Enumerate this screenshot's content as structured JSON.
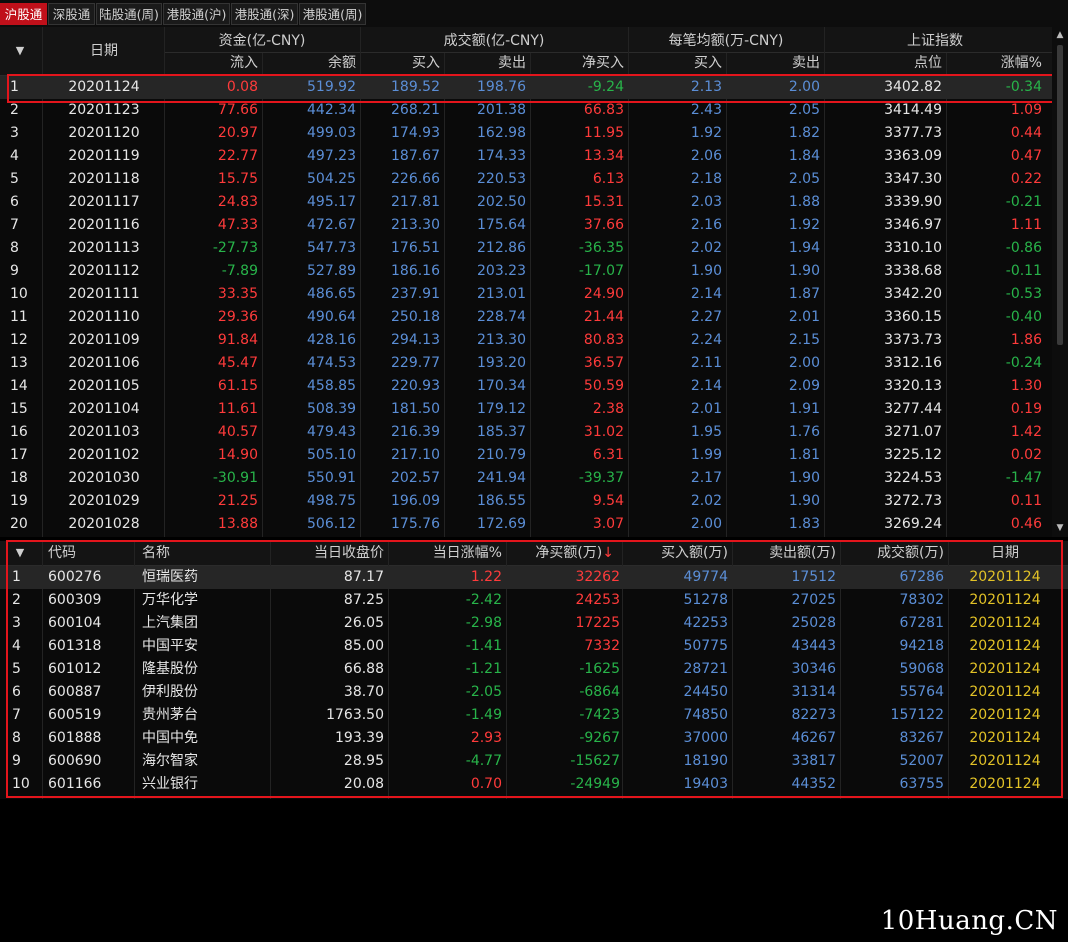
{
  "tabs": [
    "沪股通",
    "深股通",
    "陆股通(周)",
    "港股通(沪)",
    "港股通(深)",
    "港股通(周)"
  ],
  "top_header": {
    "sort_arrow": "▼",
    "date": "日期",
    "groups": [
      "资金(亿-CNY)",
      "成交额(亿-CNY)",
      "每笔均额(万-CNY)",
      "上证指数"
    ],
    "subs": [
      "流入",
      "余额",
      "买入",
      "卖出",
      "净买入",
      "买入",
      "卖出",
      "点位",
      "涨幅%"
    ]
  },
  "top_rows": [
    {
      "idx": "1",
      "date": "20201124",
      "inflow": "0.08",
      "balance": "519.92",
      "buy": "189.52",
      "sell": "198.76",
      "net": "-9.24",
      "avg_buy": "2.13",
      "avg_sell": "2.00",
      "index": "3402.82",
      "chg": "-0.34"
    },
    {
      "idx": "2",
      "date": "20201123",
      "inflow": "77.66",
      "balance": "442.34",
      "buy": "268.21",
      "sell": "201.38",
      "net": "66.83",
      "avg_buy": "2.43",
      "avg_sell": "2.05",
      "index": "3414.49",
      "chg": "1.09"
    },
    {
      "idx": "3",
      "date": "20201120",
      "inflow": "20.97",
      "balance": "499.03",
      "buy": "174.93",
      "sell": "162.98",
      "net": "11.95",
      "avg_buy": "1.92",
      "avg_sell": "1.82",
      "index": "3377.73",
      "chg": "0.44"
    },
    {
      "idx": "4",
      "date": "20201119",
      "inflow": "22.77",
      "balance": "497.23",
      "buy": "187.67",
      "sell": "174.33",
      "net": "13.34",
      "avg_buy": "2.06",
      "avg_sell": "1.84",
      "index": "3363.09",
      "chg": "0.47"
    },
    {
      "idx": "5",
      "date": "20201118",
      "inflow": "15.75",
      "balance": "504.25",
      "buy": "226.66",
      "sell": "220.53",
      "net": "6.13",
      "avg_buy": "2.18",
      "avg_sell": "2.05",
      "index": "3347.30",
      "chg": "0.22"
    },
    {
      "idx": "6",
      "date": "20201117",
      "inflow": "24.83",
      "balance": "495.17",
      "buy": "217.81",
      "sell": "202.50",
      "net": "15.31",
      "avg_buy": "2.03",
      "avg_sell": "1.88",
      "index": "3339.90",
      "chg": "-0.21"
    },
    {
      "idx": "7",
      "date": "20201116",
      "inflow": "47.33",
      "balance": "472.67",
      "buy": "213.30",
      "sell": "175.64",
      "net": "37.66",
      "avg_buy": "2.16",
      "avg_sell": "1.92",
      "index": "3346.97",
      "chg": "1.11"
    },
    {
      "idx": "8",
      "date": "20201113",
      "inflow": "-27.73",
      "balance": "547.73",
      "buy": "176.51",
      "sell": "212.86",
      "net": "-36.35",
      "avg_buy": "2.02",
      "avg_sell": "1.94",
      "index": "3310.10",
      "chg": "-0.86"
    },
    {
      "idx": "9",
      "date": "20201112",
      "inflow": "-7.89",
      "balance": "527.89",
      "buy": "186.16",
      "sell": "203.23",
      "net": "-17.07",
      "avg_buy": "1.90",
      "avg_sell": "1.90",
      "index": "3338.68",
      "chg": "-0.11"
    },
    {
      "idx": "10",
      "date": "20201111",
      "inflow": "33.35",
      "balance": "486.65",
      "buy": "237.91",
      "sell": "213.01",
      "net": "24.90",
      "avg_buy": "2.14",
      "avg_sell": "1.87",
      "index": "3342.20",
      "chg": "-0.53"
    },
    {
      "idx": "11",
      "date": "20201110",
      "inflow": "29.36",
      "balance": "490.64",
      "buy": "250.18",
      "sell": "228.74",
      "net": "21.44",
      "avg_buy": "2.27",
      "avg_sell": "2.01",
      "index": "3360.15",
      "chg": "-0.40"
    },
    {
      "idx": "12",
      "date": "20201109",
      "inflow": "91.84",
      "balance": "428.16",
      "buy": "294.13",
      "sell": "213.30",
      "net": "80.83",
      "avg_buy": "2.24",
      "avg_sell": "2.15",
      "index": "3373.73",
      "chg": "1.86"
    },
    {
      "idx": "13",
      "date": "20201106",
      "inflow": "45.47",
      "balance": "474.53",
      "buy": "229.77",
      "sell": "193.20",
      "net": "36.57",
      "avg_buy": "2.11",
      "avg_sell": "2.00",
      "index": "3312.16",
      "chg": "-0.24"
    },
    {
      "idx": "14",
      "date": "20201105",
      "inflow": "61.15",
      "balance": "458.85",
      "buy": "220.93",
      "sell": "170.34",
      "net": "50.59",
      "avg_buy": "2.14",
      "avg_sell": "2.09",
      "index": "3320.13",
      "chg": "1.30"
    },
    {
      "idx": "15",
      "date": "20201104",
      "inflow": "11.61",
      "balance": "508.39",
      "buy": "181.50",
      "sell": "179.12",
      "net": "2.38",
      "avg_buy": "2.01",
      "avg_sell": "1.91",
      "index": "3277.44",
      "chg": "0.19"
    },
    {
      "idx": "16",
      "date": "20201103",
      "inflow": "40.57",
      "balance": "479.43",
      "buy": "216.39",
      "sell": "185.37",
      "net": "31.02",
      "avg_buy": "1.95",
      "avg_sell": "1.76",
      "index": "3271.07",
      "chg": "1.42"
    },
    {
      "idx": "17",
      "date": "20201102",
      "inflow": "14.90",
      "balance": "505.10",
      "buy": "217.10",
      "sell": "210.79",
      "net": "6.31",
      "avg_buy": "1.99",
      "avg_sell": "1.81",
      "index": "3225.12",
      "chg": "0.02"
    },
    {
      "idx": "18",
      "date": "20201030",
      "inflow": "-30.91",
      "balance": "550.91",
      "buy": "202.57",
      "sell": "241.94",
      "net": "-39.37",
      "avg_buy": "2.17",
      "avg_sell": "1.90",
      "index": "3224.53",
      "chg": "-1.47"
    },
    {
      "idx": "19",
      "date": "20201029",
      "inflow": "21.25",
      "balance": "498.75",
      "buy": "196.09",
      "sell": "186.55",
      "net": "9.54",
      "avg_buy": "2.02",
      "avg_sell": "1.90",
      "index": "3272.73",
      "chg": "0.11"
    },
    {
      "idx": "20",
      "date": "20201028",
      "inflow": "13.88",
      "balance": "506.12",
      "buy": "175.76",
      "sell": "172.69",
      "net": "3.07",
      "avg_buy": "2.00",
      "avg_sell": "1.83",
      "index": "3269.24",
      "chg": "0.46"
    }
  ],
  "bottom_header": {
    "sort_arrow": "▼",
    "cols": [
      "代码",
      "名称",
      "当日收盘价",
      "当日涨幅%",
      "净买额(万)",
      "买入额(万)",
      "卖出额(万)",
      "成交额(万)",
      "日期"
    ],
    "sort_indicator": "↓"
  },
  "bottom_rows": [
    {
      "idx": "1",
      "code": "600276",
      "name": "恒瑞医药",
      "close": "87.17",
      "chg": "1.22",
      "net": "32262",
      "buy": "49774",
      "sell": "17512",
      "amount": "67286",
      "date": "20201124"
    },
    {
      "idx": "2",
      "code": "600309",
      "name": "万华化学",
      "close": "87.25",
      "chg": "-2.42",
      "net": "24253",
      "buy": "51278",
      "sell": "27025",
      "amount": "78302",
      "date": "20201124"
    },
    {
      "idx": "3",
      "code": "600104",
      "name": "上汽集团",
      "close": "26.05",
      "chg": "-2.98",
      "net": "17225",
      "buy": "42253",
      "sell": "25028",
      "amount": "67281",
      "date": "20201124"
    },
    {
      "idx": "4",
      "code": "601318",
      "name": "中国平安",
      "close": "85.00",
      "chg": "-1.41",
      "net": "7332",
      "buy": "50775",
      "sell": "43443",
      "amount": "94218",
      "date": "20201124"
    },
    {
      "idx": "5",
      "code": "601012",
      "name": "隆基股份",
      "close": "66.88",
      "chg": "-1.21",
      "net": "-1625",
      "buy": "28721",
      "sell": "30346",
      "amount": "59068",
      "date": "20201124"
    },
    {
      "idx": "6",
      "code": "600887",
      "name": "伊利股份",
      "close": "38.70",
      "chg": "-2.05",
      "net": "-6864",
      "buy": "24450",
      "sell": "31314",
      "amount": "55764",
      "date": "20201124"
    },
    {
      "idx": "7",
      "code": "600519",
      "name": "贵州茅台",
      "close": "1763.50",
      "chg": "-1.49",
      "net": "-7423",
      "buy": "74850",
      "sell": "82273",
      "amount": "157122",
      "date": "20201124"
    },
    {
      "idx": "8",
      "code": "601888",
      "name": "中国中免",
      "close": "193.39",
      "chg": "2.93",
      "net": "-9267",
      "buy": "37000",
      "sell": "46267",
      "amount": "83267",
      "date": "20201124"
    },
    {
      "idx": "9",
      "code": "600690",
      "name": "海尔智家",
      "close": "28.95",
      "chg": "-4.77",
      "net": "-15627",
      "buy": "18190",
      "sell": "33817",
      "amount": "52007",
      "date": "20201124"
    },
    {
      "idx": "10",
      "code": "601166",
      "name": "兴业银行",
      "close": "20.08",
      "chg": "0.70",
      "net": "-24949",
      "buy": "19403",
      "sell": "44352",
      "amount": "63755",
      "date": "20201124"
    }
  ],
  "watermark": "10Huang.CN",
  "colors": {
    "up": "#ff3b3b",
    "down": "#28b44a",
    "blue": "#5b8ed6",
    "date_yellow": "#e2c227",
    "highlight": "#e3151c",
    "active_tab": "#c0101a"
  }
}
